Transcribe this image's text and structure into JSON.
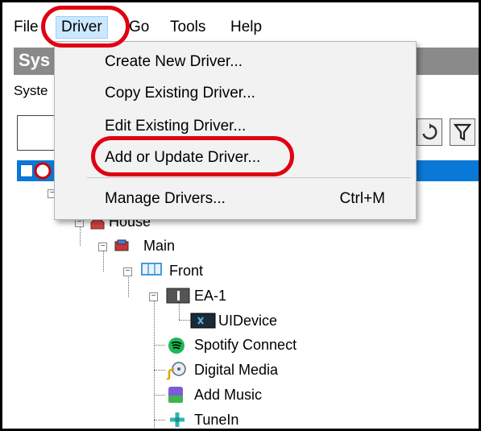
{
  "menubar": {
    "items": [
      "File",
      "Driver",
      "Go",
      "Tools",
      "Help"
    ],
    "active_index": 1
  },
  "background": {
    "title_partial": "Sys",
    "subbar_partial": "Syste"
  },
  "driver_menu": {
    "items": [
      {
        "label": "Create New Driver...",
        "shortcut": ""
      },
      {
        "label": "Copy Existing Driver...",
        "shortcut": ""
      },
      {
        "label": "Edit Existing Driver...",
        "shortcut": ""
      },
      {
        "label": "Add or Update Driver...",
        "shortcut": "",
        "highlighted": true
      },
      {
        "label": "Manage Drivers...",
        "shortcut": "Ctrl+M"
      }
    ]
  },
  "tree": {
    "nodes": [
      {
        "label": "House",
        "icon": "house-icon"
      },
      {
        "label": "Main",
        "icon": "floor-icon"
      },
      {
        "label": "Front",
        "icon": "room-icon"
      },
      {
        "label": "EA-1",
        "icon": "controller-icon"
      },
      {
        "label": "UIDevice",
        "icon": "ui-device-icon"
      },
      {
        "label": "Spotify Connect",
        "icon": "spotify-icon"
      },
      {
        "label": "Digital Media",
        "icon": "digital-media-icon"
      },
      {
        "label": "Add Music",
        "icon": "add-music-icon"
      },
      {
        "label": "TuneIn",
        "icon": "tunein-icon"
      }
    ]
  },
  "colors": {
    "highlight_oval": "#e00012",
    "selection": "#0a78d7",
    "menu_bg": "#f2f2f2",
    "active_menu_bg": "#cce8ff"
  }
}
